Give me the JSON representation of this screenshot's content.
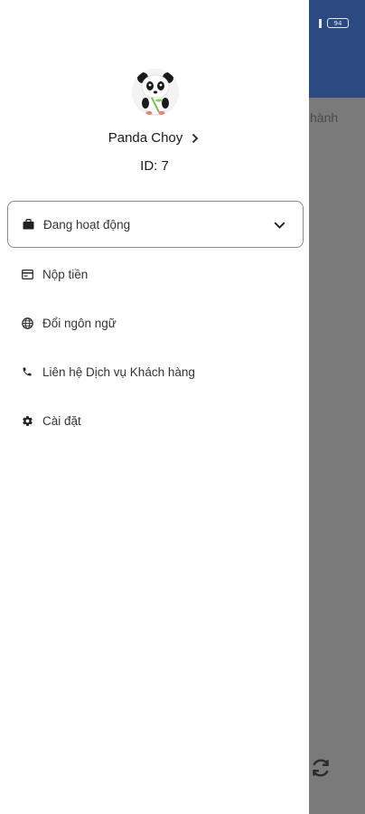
{
  "background_app": {
    "header_color": "#2c4a82",
    "battery": "94",
    "tab_partial_text": "hành"
  },
  "drawer": {
    "user": {
      "name": "Panda Choy",
      "id": "ID: 7"
    },
    "menu": [
      {
        "label": "Đang hoạt động",
        "icon": "briefcase-icon",
        "expanded": false
      },
      {
        "label": "Nộp tiền",
        "icon": "card-icon"
      },
      {
        "label": "Đổi ngôn ngữ",
        "icon": "globe-icon"
      },
      {
        "label": "Liên hệ Dịch vụ Khách hàng",
        "icon": "phone-icon"
      },
      {
        "label": "Cài đặt",
        "icon": "gear-icon"
      }
    ]
  },
  "colors": {
    "accent": "#2c4a82",
    "overlay": "#7a7a7a",
    "drawer_bg": "#ffffff"
  }
}
